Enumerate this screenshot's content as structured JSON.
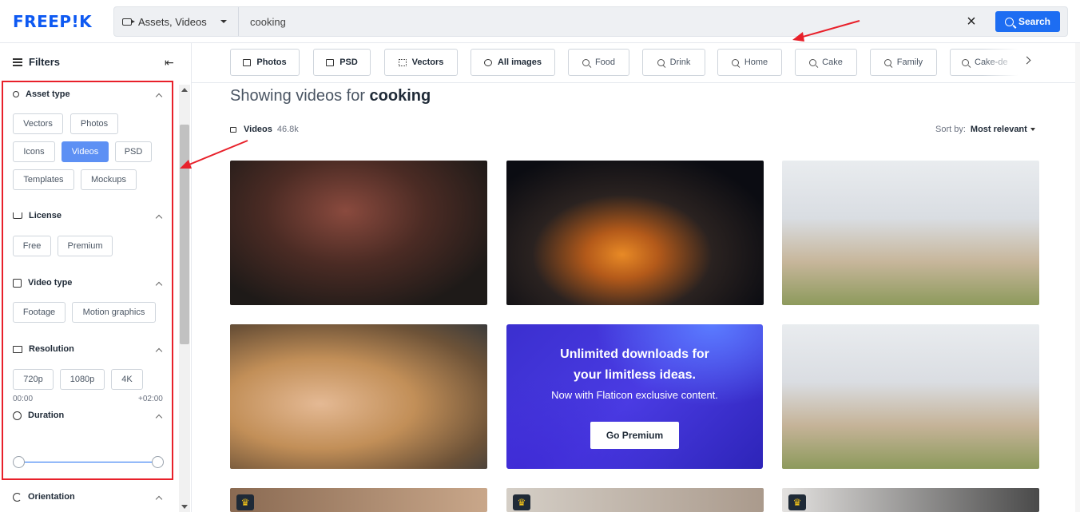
{
  "header": {
    "logo": "FREEP!K",
    "asset_type_selected": "Assets, Videos",
    "search_value": "cooking",
    "search_button": "Search"
  },
  "sidebar": {
    "title": "Filters",
    "sections": {
      "asset_type": {
        "title": "Asset type",
        "chips": [
          "Vectors",
          "Photos",
          "Icons",
          "Videos",
          "PSD",
          "Templates",
          "Mockups"
        ],
        "active": "Videos"
      },
      "license": {
        "title": "License",
        "chips": [
          "Free",
          "Premium"
        ]
      },
      "video_type": {
        "title": "Video type",
        "chips": [
          "Footage",
          "Motion graphics"
        ]
      },
      "resolution": {
        "title": "Resolution",
        "chips": [
          "720p",
          "1080p",
          "4K"
        ]
      },
      "duration": {
        "title": "Duration",
        "min": "00:00",
        "max": "+02:00"
      },
      "orientation": {
        "title": "Orientation"
      }
    }
  },
  "tags": [
    "Photos",
    "PSD",
    "Vectors",
    "All images",
    "Food",
    "Drink",
    "Home",
    "Cake",
    "Family",
    "Cake-de"
  ],
  "main": {
    "heading_prefix": "Showing videos for",
    "heading_query": "cooking",
    "results_label": "Videos",
    "results_count": "46.8k",
    "sort_label": "Sort by:",
    "sort_value": "Most relevant"
  },
  "promo": {
    "headline": "Unlimited downloads for your limitless ideas.",
    "subline": "Now with Flaticon exclusive content.",
    "button": "Go Premium"
  },
  "colors": {
    "brand": "#0e59f2",
    "search_button": "#1d6df2",
    "active_chip": "#5d90f4",
    "annotation": "#e8202a"
  }
}
